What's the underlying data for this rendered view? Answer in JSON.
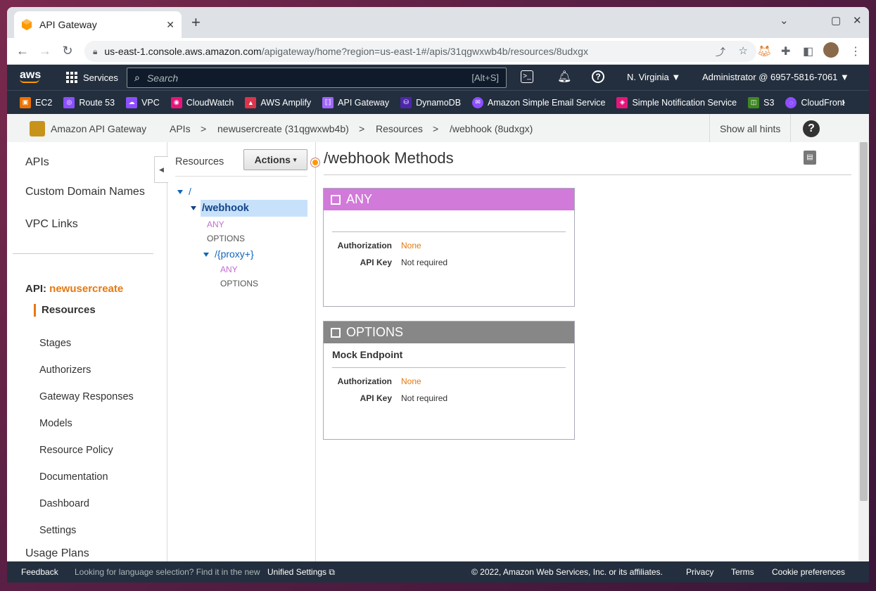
{
  "browser": {
    "tab_title": "API Gateway",
    "tab_close": "✕",
    "new_tab": "+",
    "url_host": "us-east-1.console.aws.amazon.com",
    "url_path": "/apigateway/home?region=us-east-1#/apis/31qgwxwb4b/resources/8udxgx"
  },
  "awsnav": {
    "logo": "aws",
    "services": "Services",
    "search_placeholder": "Search",
    "search_shortcut": "[Alt+S]",
    "region": "N. Virginia ▼",
    "account": "Administrator @ 6957-5816-7061 ▼"
  },
  "favorites": [
    {
      "label": "EC2",
      "color": "#ed7100"
    },
    {
      "label": "Route 53",
      "color": "#8c4fff"
    },
    {
      "label": "VPC",
      "color": "#8c4fff"
    },
    {
      "label": "CloudWatch",
      "color": "#e7157b"
    },
    {
      "label": "AWS Amplify",
      "color": "#dd344c"
    },
    {
      "label": "API Gateway",
      "color": "#a166ff"
    },
    {
      "label": "DynamoDB",
      "color": "#4d27aa"
    },
    {
      "label": "Amazon Simple Email Service",
      "color": "#8c4fff"
    },
    {
      "label": "Simple Notification Service",
      "color": "#e7157b"
    },
    {
      "label": "S3",
      "color": "#3f8624"
    },
    {
      "label": "CloudFront",
      "color": "#8c4fff"
    }
  ],
  "service_header": {
    "service_name": "Amazon API Gateway",
    "bc_apis": "APIs",
    "sep1": ">",
    "bc_api": "newusercreate (31qgwxwb4b)",
    "sep2": ">",
    "bc_resources": "Resources",
    "sep3": ">",
    "bc_resource": "/webhook (8udxgx)",
    "show_hints": "Show all hints",
    "help": "?"
  },
  "leftnav": {
    "apis": "APIs",
    "custom_domains": "Custom Domain Names",
    "vpc_links": "VPC Links",
    "api_prefix": "API:",
    "api_name": "newusercreate",
    "resources": "Resources",
    "items": [
      "Stages",
      "Authorizers",
      "Gateway Responses",
      "Models",
      "Resource Policy",
      "Documentation",
      "Dashboard",
      "Settings"
    ],
    "usage_plans": "Usage Plans"
  },
  "tree": {
    "header": "Resources",
    "actions": "Actions",
    "root": "/",
    "webhook": "/webhook",
    "webhook_any": "ANY",
    "webhook_options": "OPTIONS",
    "proxy": "/{proxy+}",
    "proxy_any": "ANY",
    "proxy_options": "OPTIONS"
  },
  "content": {
    "title": "/webhook Methods",
    "cards": [
      {
        "method": "ANY",
        "color": "#d17ad9",
        "subtitle": "",
        "auth_label": "Authorization",
        "auth_value": "None",
        "key_label": "API Key",
        "key_value": "Not required"
      },
      {
        "method": "OPTIONS",
        "color": "#878787",
        "subtitle": "Mock Endpoint",
        "auth_label": "Authorization",
        "auth_value": "None",
        "key_label": "API Key",
        "key_value": "Not required"
      }
    ]
  },
  "footer": {
    "feedback": "Feedback",
    "lang_text": "Looking for language selection? Find it in the new",
    "unified": "Unified Settings",
    "copyright": "© 2022, Amazon Web Services, Inc. or its affiliates.",
    "privacy": "Privacy",
    "terms": "Terms",
    "cookies": "Cookie preferences"
  }
}
